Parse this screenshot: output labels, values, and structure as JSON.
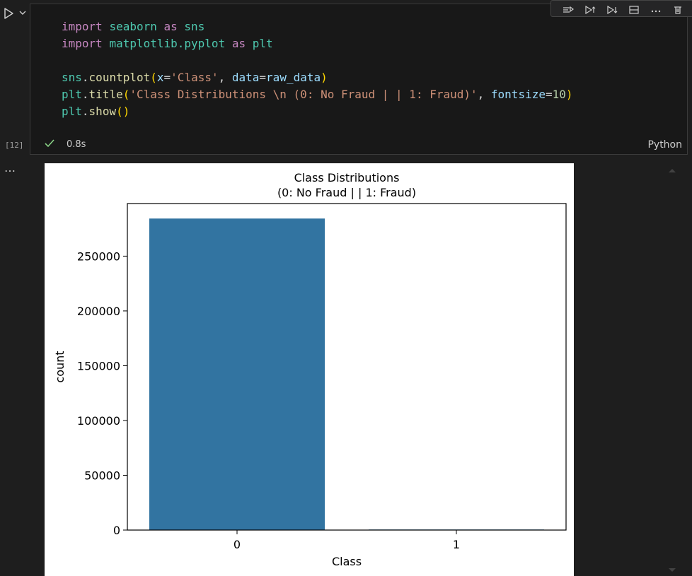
{
  "cell": {
    "exec_count": "[12]",
    "exec_time": "0.8s",
    "language": "Python",
    "code_lines": [
      [
        [
          "kw",
          "import"
        ],
        [
          "",
          " "
        ],
        [
          "mod",
          "seaborn"
        ],
        [
          "",
          " "
        ],
        [
          "kw",
          "as"
        ],
        [
          "",
          " "
        ],
        [
          "mod",
          "sns"
        ]
      ],
      [
        [
          "kw",
          "import"
        ],
        [
          "",
          " "
        ],
        [
          "mod",
          "matplotlib.pyplot"
        ],
        [
          "",
          " "
        ],
        [
          "kw",
          "as"
        ],
        [
          "",
          " "
        ],
        [
          "mod",
          "plt"
        ]
      ],
      [],
      [
        [
          "mod",
          "sns"
        ],
        [
          "",
          "."
        ],
        [
          "fn",
          "countplot"
        ],
        [
          "par",
          "("
        ],
        [
          "var",
          "x"
        ],
        [
          "",
          "="
        ],
        [
          "str",
          "'Class'"
        ],
        [
          "",
          ", "
        ],
        [
          "var",
          "data"
        ],
        [
          "",
          "="
        ],
        [
          "var",
          "raw_data"
        ],
        [
          "par",
          ")"
        ]
      ],
      [
        [
          "mod",
          "plt"
        ],
        [
          "",
          "."
        ],
        [
          "fn",
          "title"
        ],
        [
          "par",
          "("
        ],
        [
          "str",
          "'Class Distributions \\n (0: No Fraud | | 1: Fraud)'"
        ],
        [
          "",
          ", "
        ],
        [
          "var",
          "fontsize"
        ],
        [
          "",
          "="
        ],
        [
          "num",
          "10"
        ],
        [
          "par",
          ")"
        ]
      ],
      [
        [
          "mod",
          "plt"
        ],
        [
          "",
          "."
        ],
        [
          "fn",
          "show"
        ],
        [
          "par",
          "()"
        ]
      ]
    ]
  },
  "toolbar": {
    "icons": [
      "run-by-line-icon",
      "execute-above-icon",
      "execute-below-icon",
      "split-cell-icon",
      "more-actions-icon",
      "delete-cell-icon"
    ]
  },
  "output": {
    "more_label": "…"
  },
  "chart_data": {
    "type": "bar",
    "title": "Class Distributions\n(0: No Fraud | | 1: Fraud)",
    "title_lines": [
      "Class Distributions",
      "(0: No Fraud | | 1: Fraud)"
    ],
    "xlabel": "Class",
    "ylabel": "count",
    "categories": [
      "0",
      "1"
    ],
    "values": [
      284315,
      492
    ],
    "ylim": [
      0,
      298000
    ],
    "yticks": [
      0,
      50000,
      100000,
      150000,
      200000,
      250000
    ],
    "bar_color": "#3274a1",
    "grid": false,
    "legend": false
  },
  "colors": {
    "background": "#1e1e1e",
    "check": "#89d185"
  }
}
